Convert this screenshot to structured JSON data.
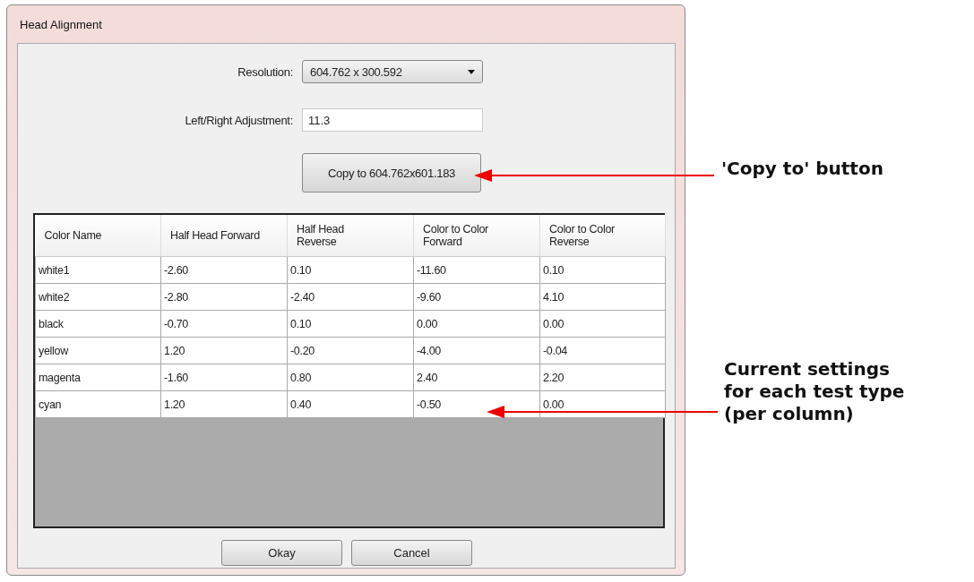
{
  "window": {
    "title": "Head Alignment"
  },
  "resolution": {
    "label": "Resolution:",
    "value": "604.762 x 300.592"
  },
  "adjustment": {
    "label": "Left/Right Adjustment:",
    "value": "11.3"
  },
  "copy_button": "Copy to 604.762x601.183",
  "table": {
    "columns": [
      "Color Name",
      "Half Head Forward",
      "Half Head Reverse",
      "Color to Color Forward",
      "Color to Color Reverse"
    ],
    "rows": [
      [
        "white1",
        "-2.60",
        "0.10",
        "-11.60",
        "0.10"
      ],
      [
        "white2",
        "-2.80",
        "-2.40",
        "-9.60",
        "4.10"
      ],
      [
        "black",
        "-0.70",
        "0.10",
        "0.00",
        "0.00"
      ],
      [
        "yellow",
        "1.20",
        "-0.20",
        "-4.00",
        "-0.04"
      ],
      [
        "magenta",
        "-1.60",
        "0.80",
        "2.40",
        "2.20"
      ],
      [
        "cyan",
        "1.20",
        "0.40",
        "-0.50",
        "0.00"
      ]
    ]
  },
  "buttons": [
    "Okay",
    "Cancel"
  ],
  "annotations": [
    {
      "lines": [
        "'Copy to' button"
      ]
    },
    {
      "lines": [
        "Current settings",
        "for each test type",
        "(per column)"
      ]
    }
  ]
}
